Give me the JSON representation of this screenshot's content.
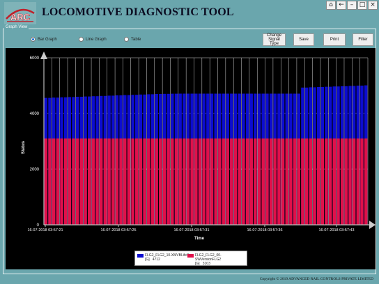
{
  "app": {
    "title": "LOCOMOTIVE DIAGNOSTIC TOOL",
    "logo_text": "ARC",
    "copyright": "Copyright © 2019 ADVANCED RAIL CONTROLS PRIVATE LIMITED"
  },
  "window_buttons": {
    "home": "⌂",
    "back": "←",
    "minimize": "–",
    "maximize": "□",
    "close": "×"
  },
  "graph_view": {
    "label": "Graph View",
    "options": [
      {
        "label": "Bar Graph",
        "selected": true
      },
      {
        "label": "Line Graph",
        "selected": false
      },
      {
        "label": "Table",
        "selected": false
      }
    ],
    "buttons": {
      "change_line1": "Change",
      "change_line2": "Signal Type",
      "save": "Save",
      "print": "Print",
      "filter": "Filter"
    }
  },
  "chart_data": {
    "type": "bar",
    "title": "",
    "xlabel": "Time",
    "ylabel": "Status",
    "ylim": [
      0,
      6000
    ],
    "yticks": [
      0,
      2000,
      4000,
      6000
    ],
    "xtick_labels": [
      "16-07-2018 03:57:21",
      "16-07-2018 03:57:25",
      "16-07-2018 03:57:31",
      "16-07-2018 03:57:36",
      "16-07-2018 03:57:43"
    ],
    "bar_count": 82,
    "grid": true,
    "legend_position": "bottom",
    "colors": {
      "s1": "#0c0cd0",
      "s2": "#e0104a"
    },
    "series": [
      {
        "name": "FLG2_FLG2_10-XMVBLifeSig",
        "unit": "[G]",
        "value_label": "4712",
        "values": [
          4560,
          4560,
          4570,
          4570,
          4580,
          4580,
          4590,
          4590,
          4600,
          4600,
          4610,
          4610,
          4620,
          4620,
          4630,
          4630,
          4640,
          4640,
          4650,
          4650,
          4660,
          4660,
          4670,
          4670,
          4680,
          4680,
          4690,
          4690,
          4700,
          4700,
          4705,
          4705,
          4710,
          4710,
          4712,
          4712,
          4712,
          4712,
          4712,
          4712,
          4712,
          4712,
          4712,
          4712,
          4712,
          4712,
          4712,
          4712,
          4712,
          4712,
          4712,
          4712,
          4712,
          4712,
          4712,
          4712,
          4712,
          4712,
          4712,
          4712,
          4712,
          4712,
          4712,
          4712,
          4712,
          4930,
          4930,
          4940,
          4940,
          4950,
          4950,
          4960,
          4960,
          4970,
          4970,
          4980,
          4980,
          4990,
          4990,
          5000,
          5000,
          5010
        ]
      },
      {
        "name": "FLG2_FLG2_00-SWVersionFLG2",
        "unit": "[G]",
        "value_label": "3103",
        "values": [
          3103,
          3103,
          3103,
          3103,
          3103,
          3103,
          3103,
          3103,
          3103,
          3103,
          3103,
          3103,
          3103,
          3103,
          3103,
          3103,
          3103,
          3103,
          3103,
          3103,
          3103,
          3103,
          3103,
          3103,
          3103,
          3103,
          3103,
          3103,
          3103,
          3103,
          3103,
          3103,
          3103,
          3103,
          3103,
          3103,
          3103,
          3103,
          3103,
          3103,
          3103,
          3103,
          3103,
          3103,
          3103,
          3103,
          3103,
          3103,
          3103,
          3103,
          3103,
          3103,
          3103,
          3103,
          3103,
          3103,
          3103,
          3103,
          3103,
          3103,
          3103,
          3103,
          3103,
          3103,
          3103,
          3103,
          3103,
          3103,
          3103,
          3103,
          3103,
          3103,
          3103,
          3103,
          3103,
          3103,
          3103,
          3103,
          3103,
          3103,
          3103,
          3103
        ]
      }
    ]
  }
}
